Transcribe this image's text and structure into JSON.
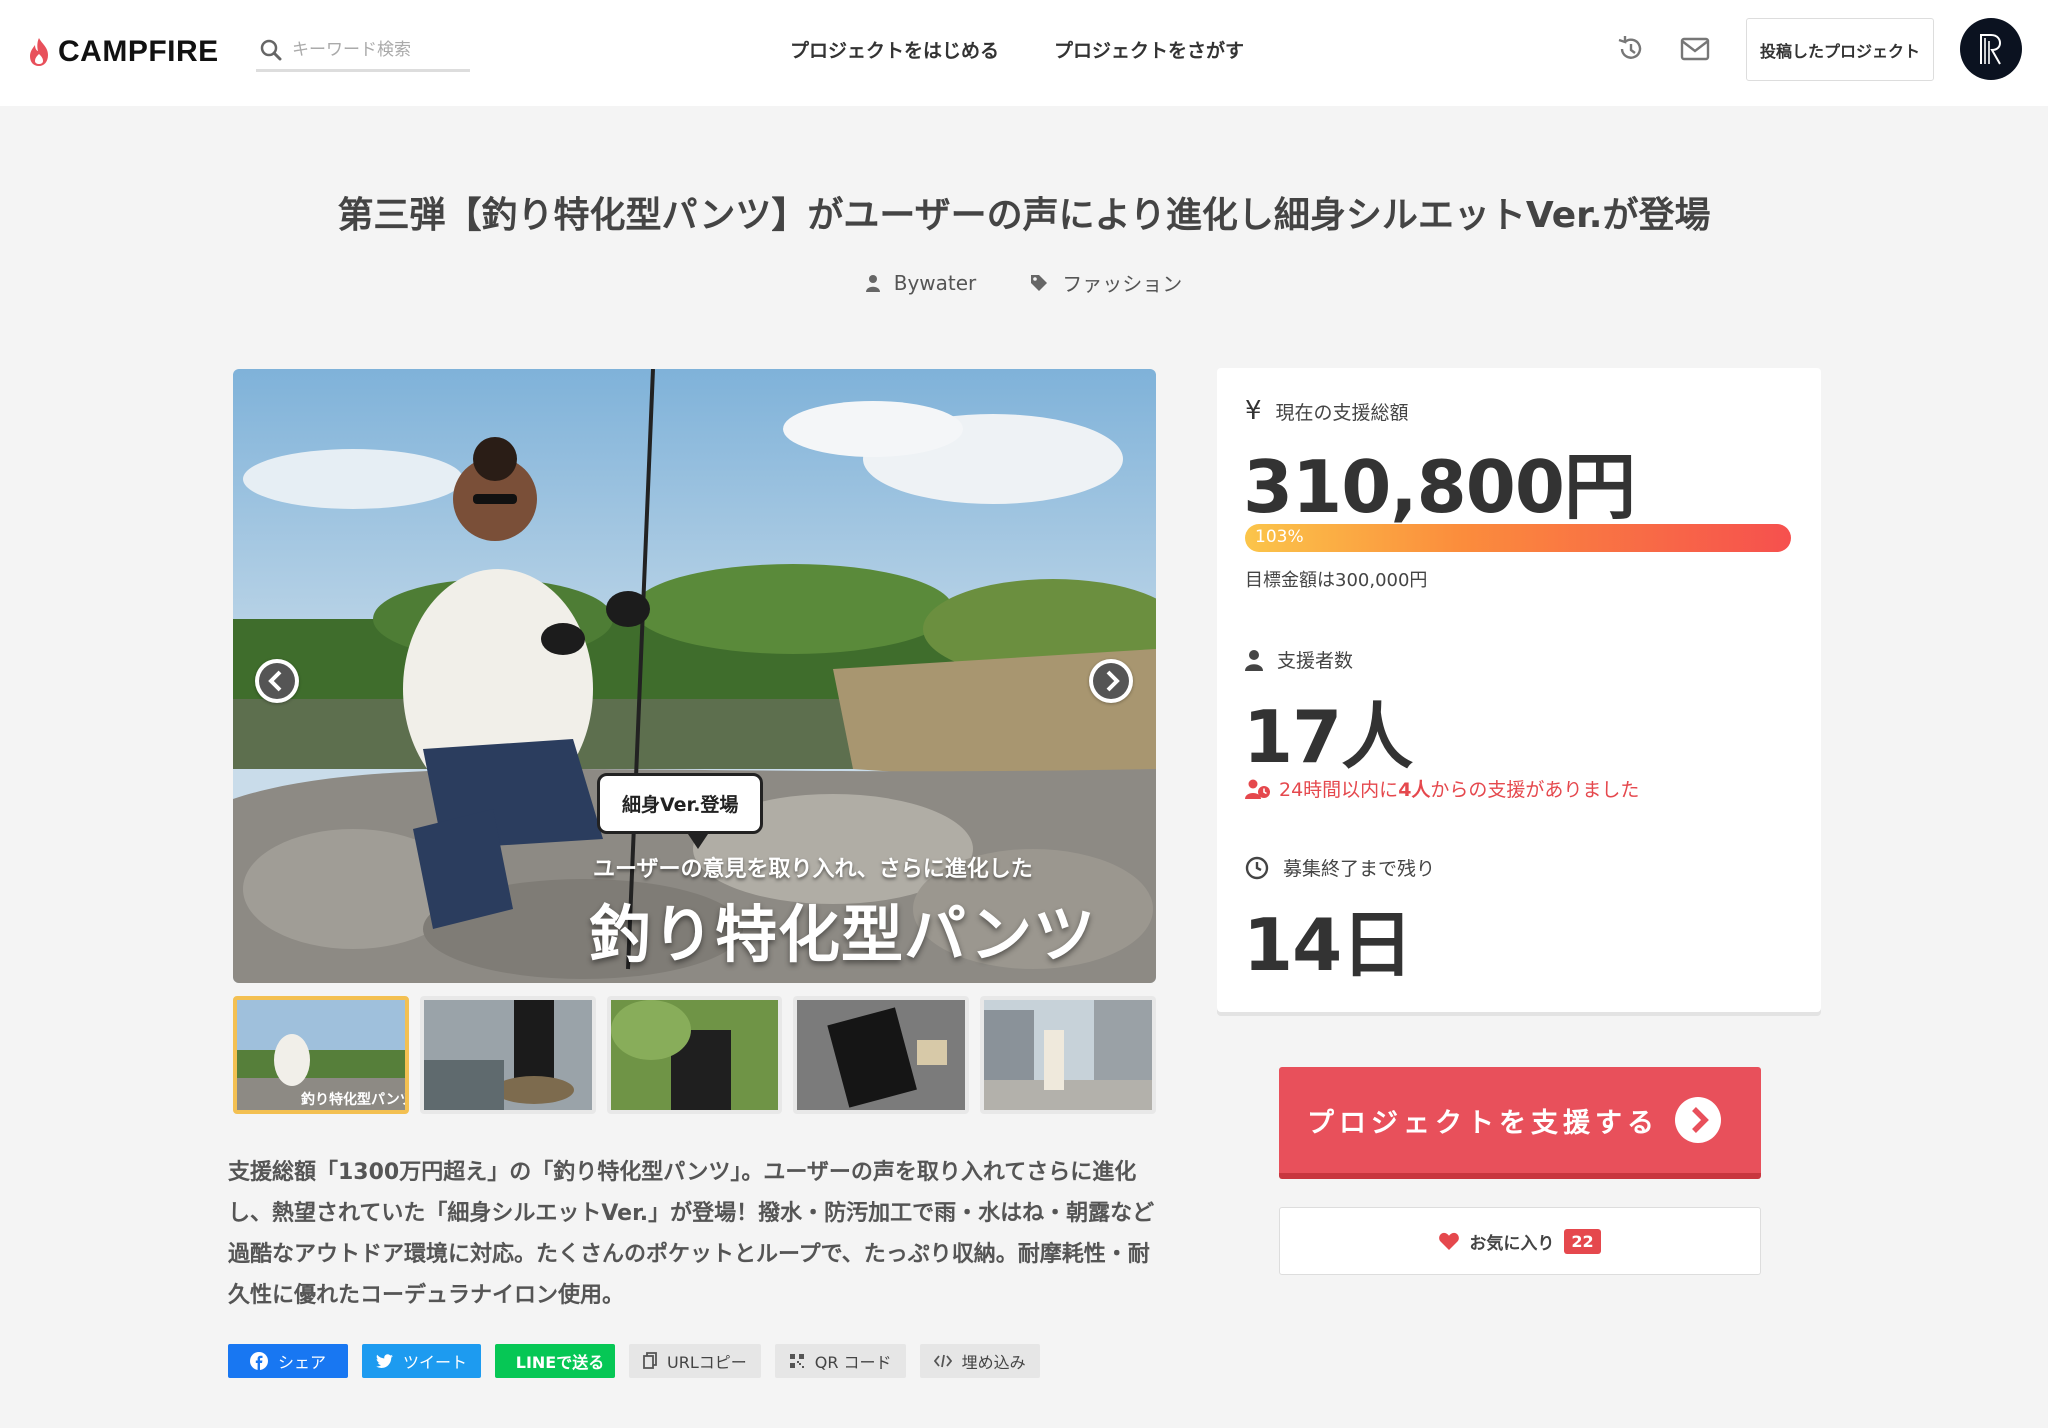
{
  "header": {
    "logo_text": "CAMPFIRE",
    "search_placeholder": "キーワード検索",
    "nav_start": "プロジェクトをはじめる",
    "nav_find": "プロジェクトをさがす",
    "posted_projects": "投稿したプロジェクト",
    "icons": [
      "flame-icon",
      "search-icon",
      "history-icon",
      "mail-icon"
    ]
  },
  "project": {
    "title": "第三弾【釣り特化型パンツ】がユーザーの声により進化し細身シルエットVer.が登場",
    "owner": "Bywater",
    "category": "ファッション",
    "description": "支援総額「1300万円超え」の「釣り特化型パンツ」。ユーザーの声を取り入れてさらに進化し、熱望されていた「細身シルエットVer.」が登場！撥水・防汚加工で雨・水はね・朝露など過酷なアウトドア環境に対応。たくさんのポケットとループで、たっぷり収納。耐摩耗性・耐久性に優れたコーデュラナイロン使用。"
  },
  "gallery": {
    "bubble": "細身Ver.登場",
    "overlay_sub": "ユーザーの意見を取り入れ、さらに進化した",
    "overlay_main": "釣り特化型パンツ",
    "thumb_count": 5,
    "active_thumb": 0
  },
  "stats": {
    "total_label": "現在の支援総額",
    "total_value": "310,800円",
    "progress_text": "103%",
    "progress_fraction": 1.03,
    "goal_text": "目標金額は300,000円",
    "backers_label": "支援者数",
    "backers_value": "17人",
    "recent_prefix": "24時間以内に",
    "recent_count": "4人",
    "recent_suffix": "からの支援がありました",
    "remaining_label": "募集終了まで残り",
    "remaining_value": "14日"
  },
  "actions": {
    "support_button": "プロジェクトを支援する",
    "favorite_label": "お気に入り",
    "favorite_count": "22"
  },
  "share": {
    "facebook": "シェア",
    "twitter": "ツイート",
    "line": "LINEで送る",
    "copy_url": "URLコピー",
    "qr": "QR コード",
    "embed": "埋め込み"
  },
  "colors": {
    "accent_red": "#e8505b",
    "facebook": "#1877f2",
    "twitter": "#1d9bf0",
    "line": "#06c755",
    "active_thumb_border": "#f3c052"
  }
}
